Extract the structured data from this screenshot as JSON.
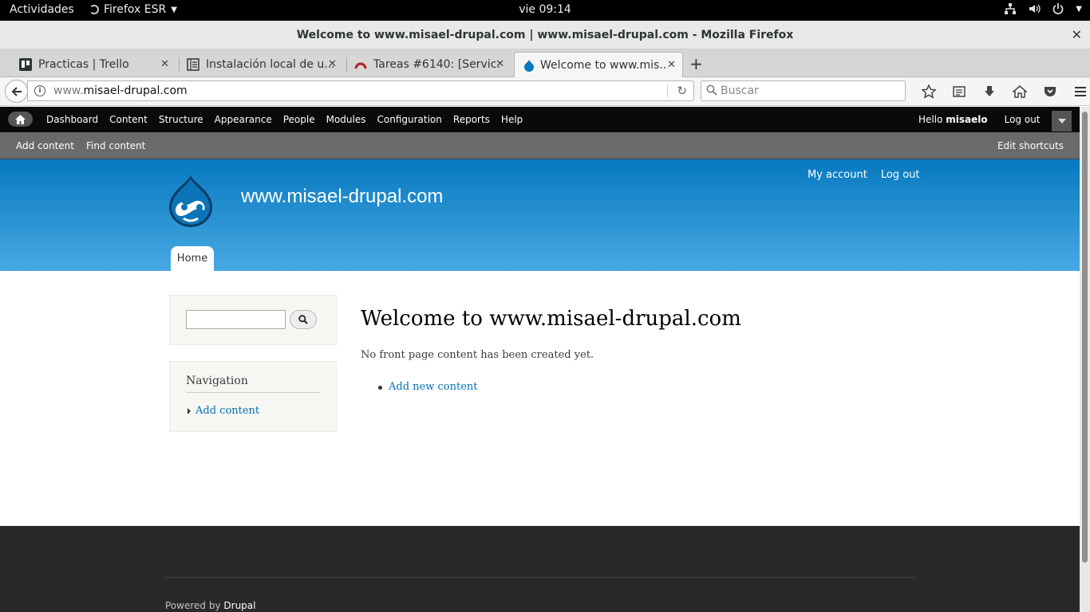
{
  "gnome": {
    "activities": "Actividades",
    "app_name": "Firefox ESR",
    "clock": "vie 09:14"
  },
  "window": {
    "title": "Welcome to www.misael-drupal.com | www.misael-drupal.com - Mozilla Firefox"
  },
  "tabs": [
    {
      "label": "Practicas | Trello",
      "icon": "trello-icon",
      "active": false
    },
    {
      "label": "Instalación local de u...",
      "icon": "page-icon",
      "active": false
    },
    {
      "label": "Tareas #6140: [Servic...",
      "icon": "redmine-icon",
      "active": false
    },
    {
      "label": "Welcome to www.mis...",
      "icon": "drupal-icon",
      "active": true
    }
  ],
  "navbar": {
    "url_prefix": "www.",
    "url_host": "misael-drupal.com",
    "search_placeholder": "Buscar"
  },
  "drupal_toolbar": {
    "menu": [
      "Dashboard",
      "Content",
      "Structure",
      "Appearance",
      "People",
      "Modules",
      "Configuration",
      "Reports",
      "Help"
    ],
    "hello": "Hello",
    "username": "misaelo",
    "logout": "Log out"
  },
  "shortcuts": {
    "add_content": "Add content",
    "find_content": "Find content",
    "edit_shortcuts": "Edit shortcuts"
  },
  "header": {
    "site_name": "www.misael-drupal.com",
    "my_account": "My account",
    "log_out": "Log out",
    "home_tab": "Home"
  },
  "sidebar": {
    "nav_title": "Navigation",
    "nav_link": "Add content"
  },
  "main": {
    "title": "Welcome to www.misael-drupal.com",
    "text": "No front page content has been created yet.",
    "link": "Add new content"
  },
  "footer": {
    "powered_by": "Powered by",
    "drupal": "Drupal"
  },
  "colors": {
    "header_top": "#0779bf",
    "header_bottom": "#48a9e4",
    "link": "#0071b3",
    "footer_bg": "#292929"
  }
}
